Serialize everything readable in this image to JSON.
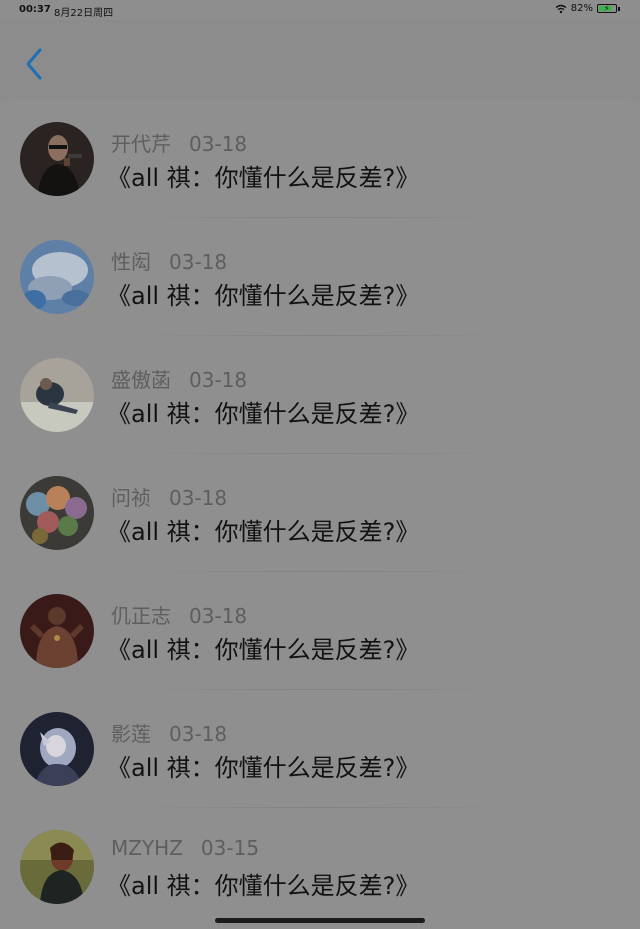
{
  "status": {
    "time": "00:37",
    "date": "8月22日周四",
    "battery": "82%",
    "battery_level": 0.82
  },
  "nav": {
    "back_icon": "chevron-left-icon",
    "accent_color": "#1f6fb5"
  },
  "items": [
    {
      "author": "开代芹",
      "date": "03-18",
      "title": "《all 祺：你懂什么是反差?》",
      "avatar": "man-with-gun"
    },
    {
      "author": "性闳",
      "date": "03-18",
      "title": "《all 祺：你懂什么是反差?》",
      "avatar": "blue-clouds"
    },
    {
      "author": "盛傲菡",
      "date": "03-18",
      "title": "《all 祺：你懂什么是反差?》",
      "avatar": "person-sitting"
    },
    {
      "author": "问祯",
      "date": "03-18",
      "title": "《all 祺：你懂什么是反差?》",
      "avatar": "balloons"
    },
    {
      "author": "仉正志",
      "date": "03-18",
      "title": "《all 祺：你懂什么是反差?》",
      "avatar": "tattooed-man"
    },
    {
      "author": "影莲",
      "date": "03-18",
      "title": "《all 祺：你懂什么是反差?》",
      "avatar": "anime-girl"
    },
    {
      "author": "MZYHZ",
      "date": "03-15",
      "title": "《all 祺：你懂什么是反差?》",
      "avatar": "woman-portrait"
    }
  ]
}
